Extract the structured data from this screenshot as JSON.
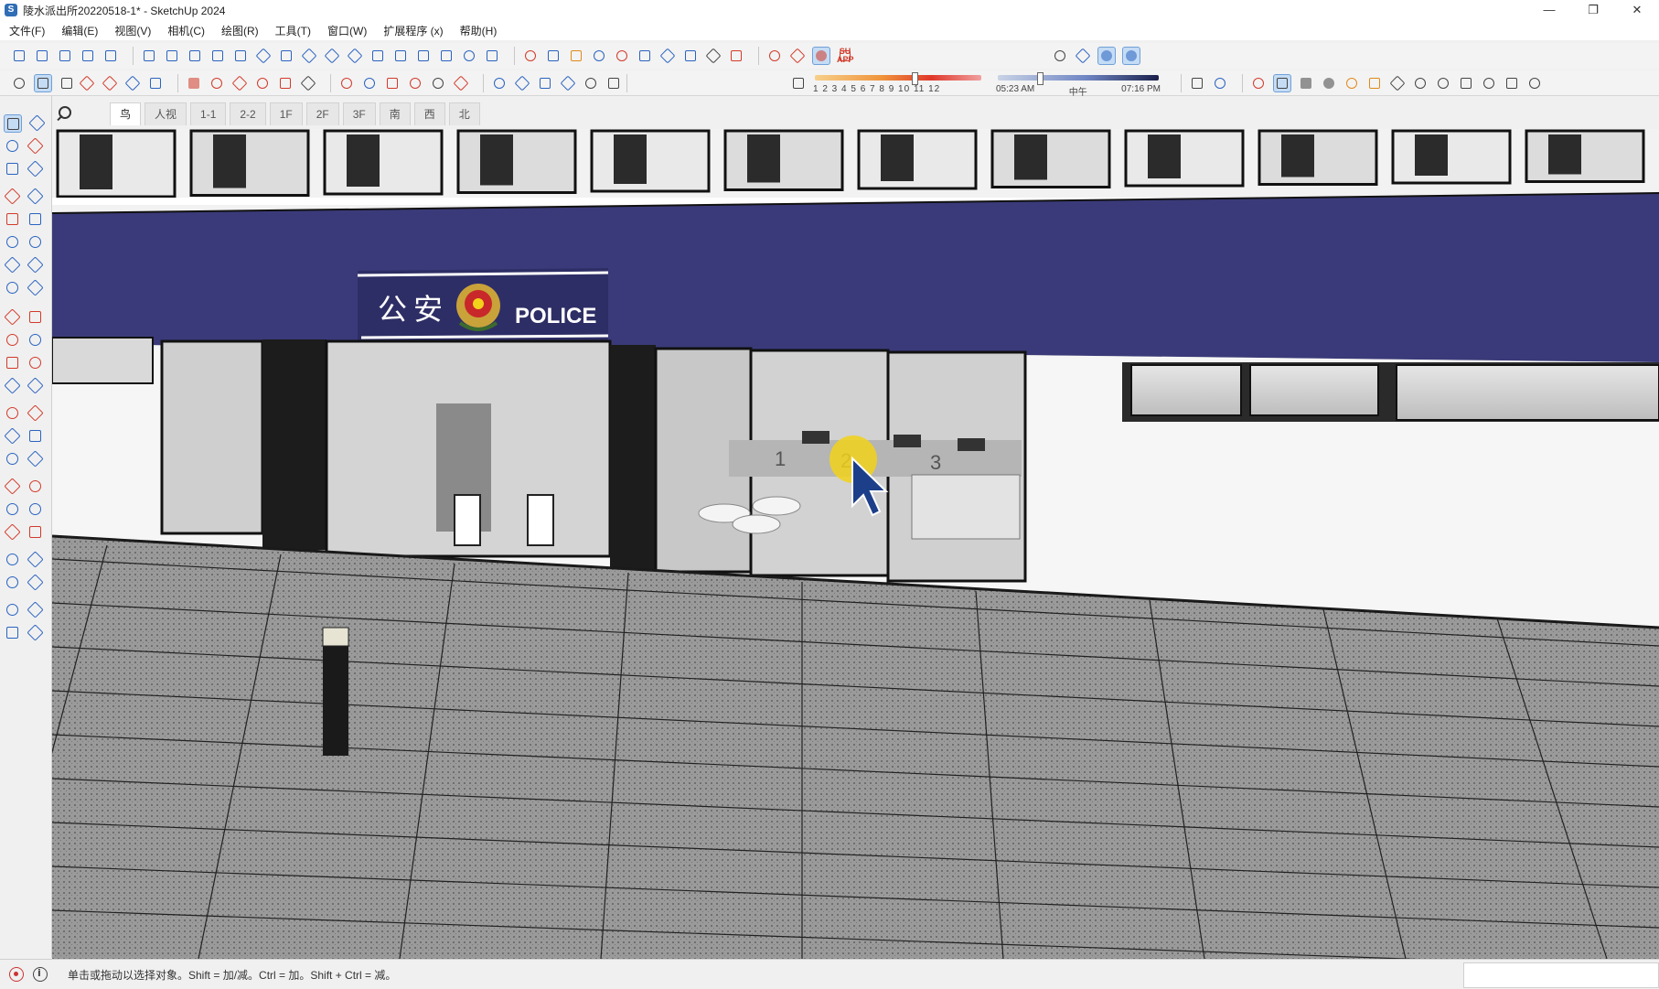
{
  "window": {
    "title": "陵水派出所20220518-1* - SketchUp 2024",
    "app_icon": "sketchup-icon",
    "controls": [
      "—",
      "❐",
      "✕"
    ]
  },
  "menu": [
    "文件(F)",
    "编辑(E)",
    "视图(V)",
    "相机(C)",
    "绘图(R)",
    "工具(T)",
    "窗口(W)",
    "扩展程序 (x)",
    "帮助(H)"
  ],
  "toolbar": {
    "su_badge": "SU",
    "su_badge_sub": "APP",
    "shadow_months": "1 2 3 4 5 6 7 8 9 10 11 12",
    "time_start": "05:23 AM",
    "time_mid": "中午",
    "time_end": "07:16 PM",
    "shadow_month_position": 0.6,
    "shadow_time_position": 0.26
  },
  "scene_tabs": [
    "鸟",
    "人视",
    "1-1",
    "2-2",
    "1F",
    "2F",
    "3F",
    "南",
    "西",
    "北"
  ],
  "active_tab_index": 0,
  "viewport": {
    "sign_cn_1": "公",
    "sign_cn_2": "安",
    "sign_en": "POLICE",
    "counter_1": "1",
    "counter_2": "2",
    "counter_3": "3",
    "colors": {
      "facade_band": "#3a3a7a",
      "ground": "#8a8a8a",
      "glass": "#cfcfcf",
      "cursor_highlight": "#f2d21a"
    }
  },
  "status": {
    "text": "单击或拖动以选择对象。Shift = 加/减。Ctrl = 加。Shift + Ctrl = 减。",
    "geo_icon": "geolocation-icon",
    "info_icon": "info-icon"
  }
}
